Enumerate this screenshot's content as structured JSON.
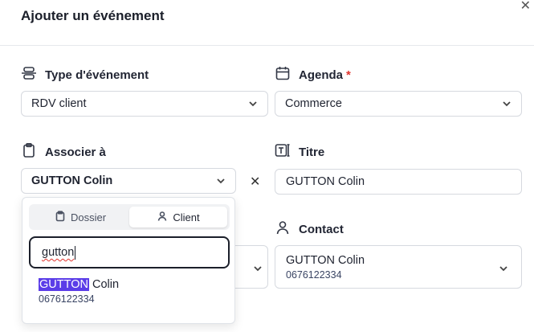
{
  "modal": {
    "title": "Ajouter un événement",
    "close_glyph": "✕"
  },
  "fields": {
    "type": {
      "label": "Type d'événement",
      "icon": "split-vertical-icon",
      "value": "RDV client"
    },
    "agenda": {
      "label": "Agenda",
      "required_mark": "*",
      "icon": "calendar-icon",
      "value": "Commerce"
    },
    "associer": {
      "label": "Associer à",
      "icon": "clipboard-icon",
      "value": "GUTTON Colin",
      "clear_glyph": "✕"
    },
    "titre": {
      "label": "Titre",
      "icon": "text-cursor-icon",
      "value": "GUTTON Colin"
    },
    "contact": {
      "label": "Contact",
      "icon": "user-icon",
      "name": "GUTTON Colin",
      "phone": "0676122334"
    }
  },
  "popover": {
    "tabs": [
      {
        "label": "Dossier",
        "icon": "clipboard-icon",
        "active": false
      },
      {
        "label": "Client",
        "icon": "user-icon",
        "active": true
      }
    ],
    "search_value": "gutton",
    "results": [
      {
        "highlight": "GUTTON",
        "rest": " Colin",
        "phone": "0676122334"
      }
    ]
  },
  "colors": {
    "required": "#e0342e",
    "highlight": "#5b3de8",
    "border": "#d6d9df"
  }
}
